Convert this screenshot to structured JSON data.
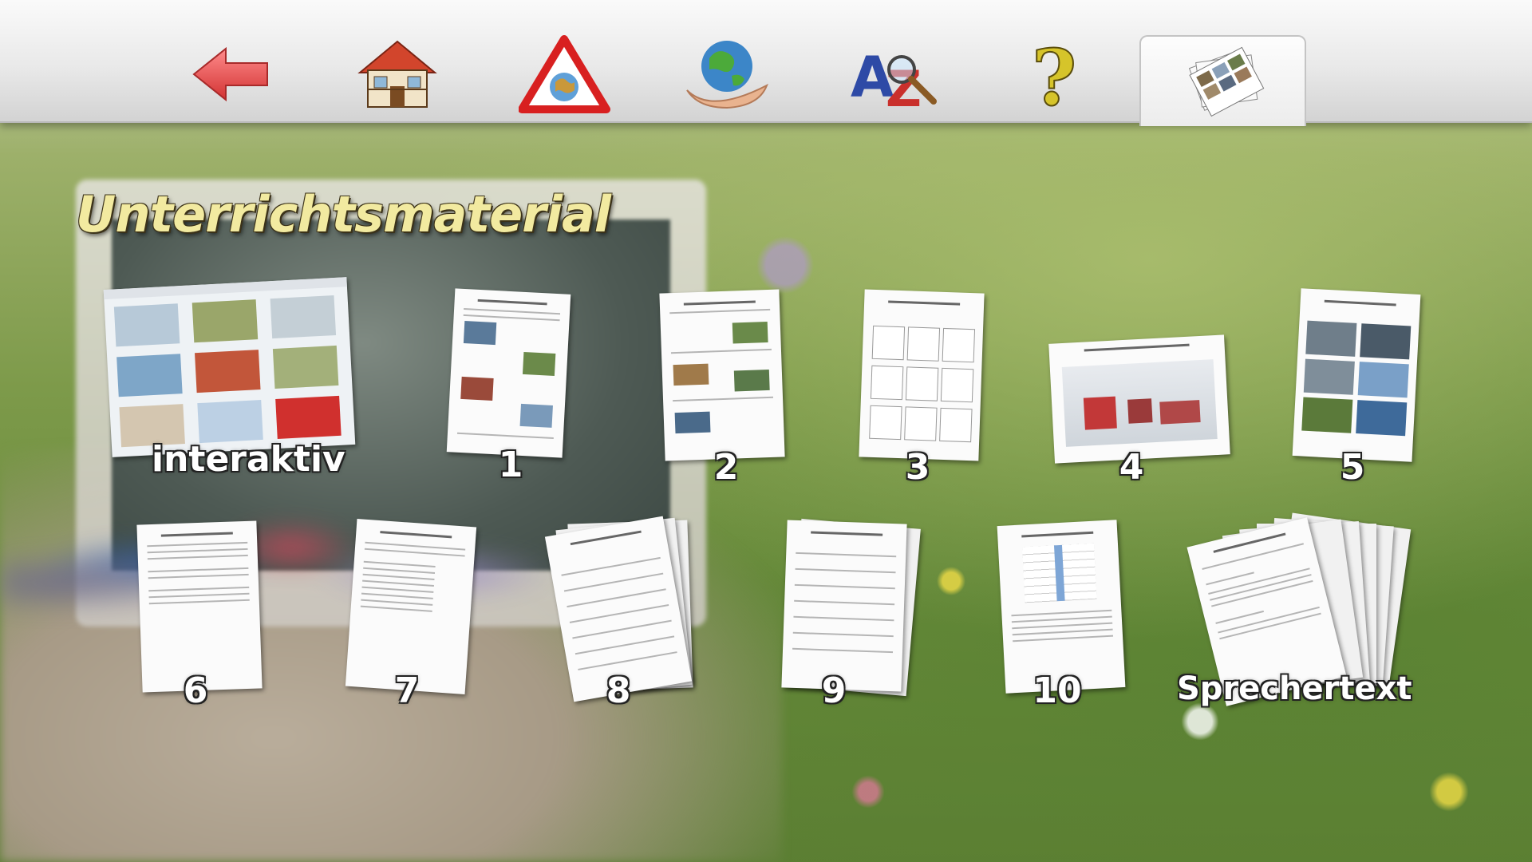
{
  "toolbar": {
    "buttons": [
      {
        "id": "back",
        "icon": "back-arrow-icon"
      },
      {
        "id": "home",
        "icon": "house-icon"
      },
      {
        "id": "warning",
        "icon": "warning-globe-icon"
      },
      {
        "id": "environment",
        "icon": "globe-in-hands-icon"
      },
      {
        "id": "glossary",
        "icon": "a-z-magnifier-icon"
      },
      {
        "id": "help",
        "icon": "question-mark-icon"
      },
      {
        "id": "materials",
        "icon": "photo-stack-icon",
        "active": true
      }
    ]
  },
  "page": {
    "title": "Unterrichtsmaterial"
  },
  "materials": [
    {
      "label": "interaktiv"
    },
    {
      "label": "1"
    },
    {
      "label": "2"
    },
    {
      "label": "3"
    },
    {
      "label": "4"
    },
    {
      "label": "5"
    },
    {
      "label": "6"
    },
    {
      "label": "7"
    },
    {
      "label": "8"
    },
    {
      "label": "9"
    },
    {
      "label": "10"
    },
    {
      "label": "Sprechertext"
    }
  ],
  "colors": {
    "title": "#f2eaa0",
    "back_arrow": "#e24a4a",
    "toolbar": "#e9e9e9"
  }
}
